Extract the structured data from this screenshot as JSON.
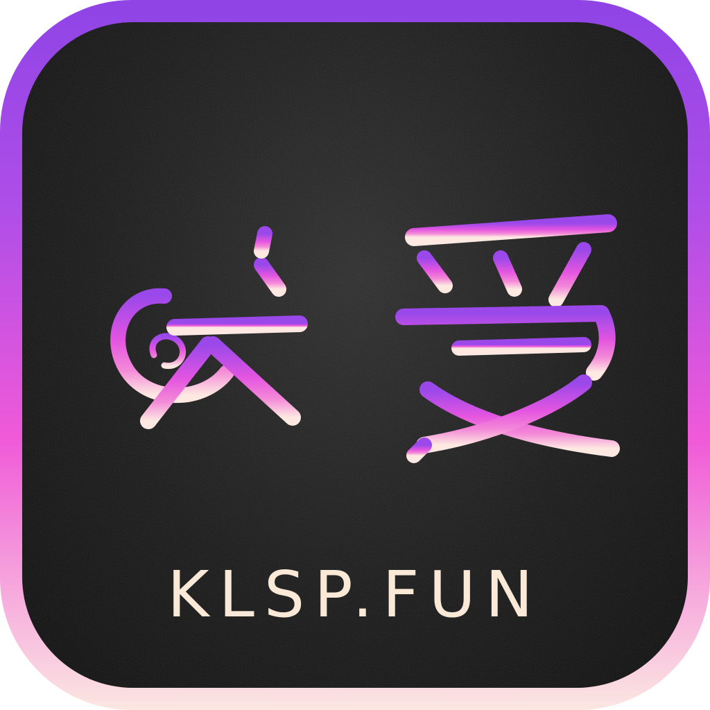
{
  "app_icon": {
    "logo_text": "咪爱",
    "domain": "KLSP.FUN",
    "logo_icon": "mi-ai-calligraphy-icon",
    "colors": {
      "gradient_top": "#8f44e6",
      "gradient_mid": "#f05ad8",
      "gradient_bottom": "#fbe7e1",
      "background": "#111111",
      "domain_text": "#fbe9d7"
    }
  }
}
